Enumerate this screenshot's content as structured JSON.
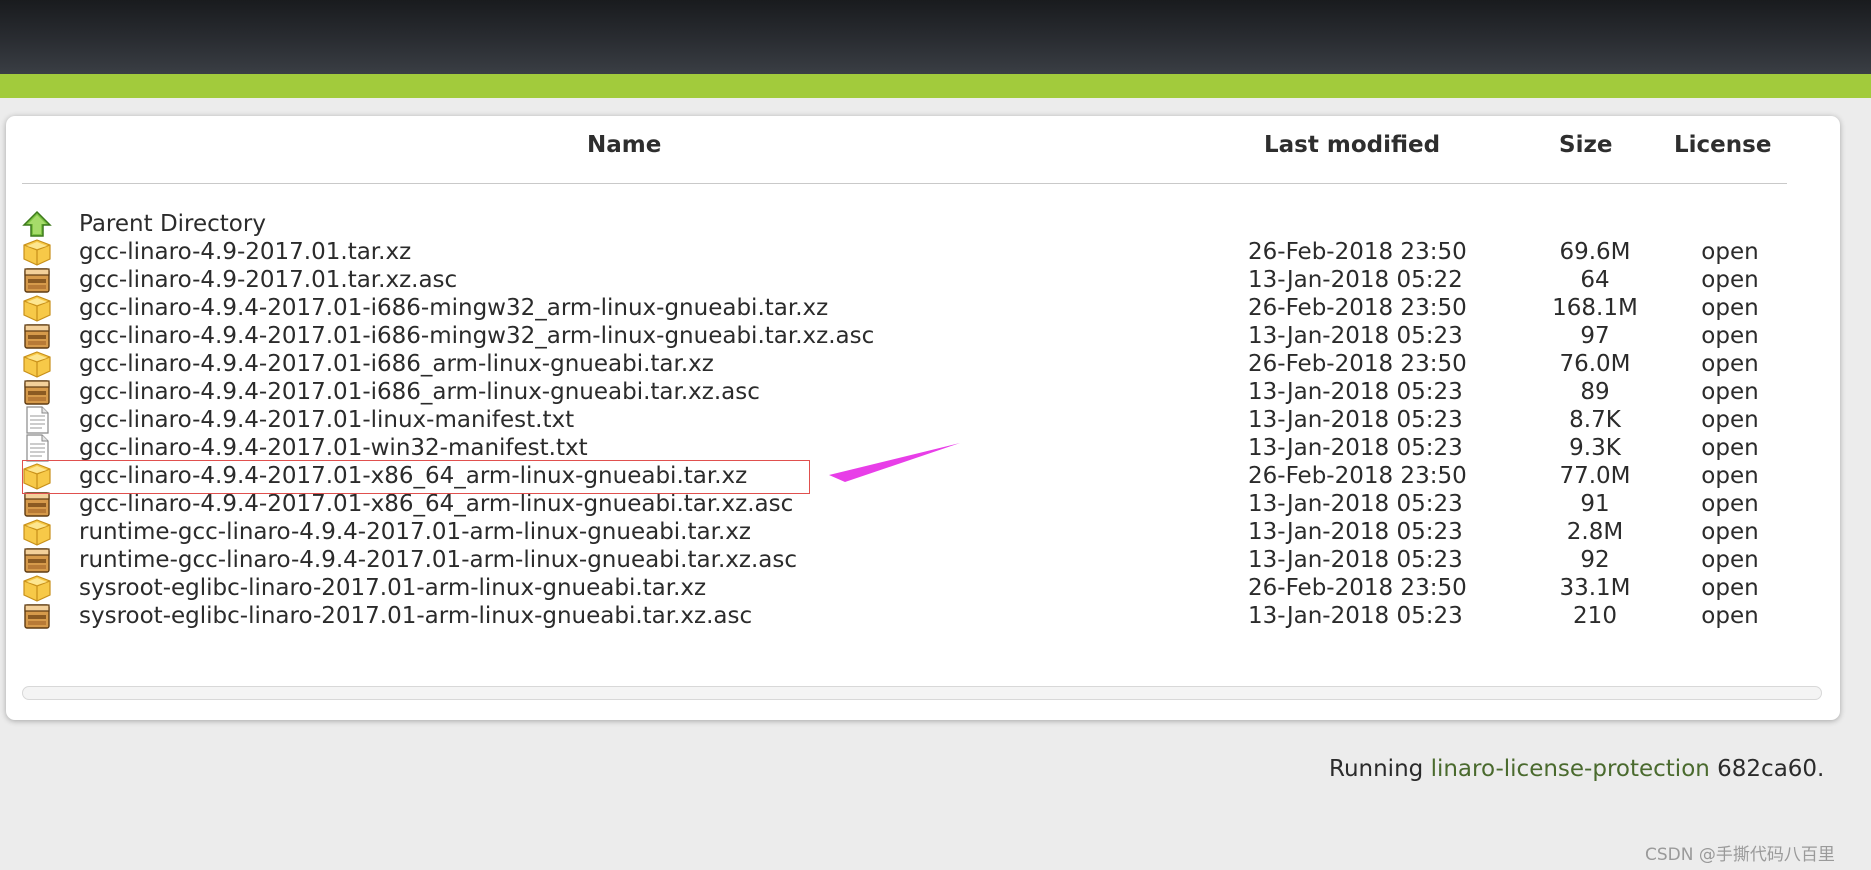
{
  "table": {
    "headers": {
      "name": "Name",
      "last_modified": "Last modified",
      "size": "Size",
      "license": "License"
    },
    "parent": {
      "label": "Parent Directory",
      "icon": "back-arrow-icon"
    },
    "rows": [
      {
        "name": "gcc-linaro-4.9-2017.01.tar.xz",
        "modified": "26-Feb-2018 23:50",
        "size": "69.6M",
        "license": "open",
        "icon": "archive-icon"
      },
      {
        "name": "gcc-linaro-4.9-2017.01.tar.xz.asc",
        "modified": "13-Jan-2018 05:22",
        "size": "64",
        "license": "open",
        "icon": "package-icon"
      },
      {
        "name": "gcc-linaro-4.9.4-2017.01-i686-mingw32_arm-linux-gnueabi.tar.xz",
        "modified": "26-Feb-2018 23:50",
        "size": "168.1M",
        "license": "open",
        "icon": "archive-icon"
      },
      {
        "name": "gcc-linaro-4.9.4-2017.01-i686-mingw32_arm-linux-gnueabi.tar.xz.asc",
        "modified": "13-Jan-2018 05:23",
        "size": "97",
        "license": "open",
        "icon": "package-icon"
      },
      {
        "name": "gcc-linaro-4.9.4-2017.01-i686_arm-linux-gnueabi.tar.xz",
        "modified": "26-Feb-2018 23:50",
        "size": "76.0M",
        "license": "open",
        "icon": "archive-icon"
      },
      {
        "name": "gcc-linaro-4.9.4-2017.01-i686_arm-linux-gnueabi.tar.xz.asc",
        "modified": "13-Jan-2018 05:23",
        "size": "89",
        "license": "open",
        "icon": "package-icon"
      },
      {
        "name": "gcc-linaro-4.9.4-2017.01-linux-manifest.txt",
        "modified": "13-Jan-2018 05:23",
        "size": "8.7K",
        "license": "open",
        "icon": "text-file-icon"
      },
      {
        "name": "gcc-linaro-4.9.4-2017.01-win32-manifest.txt",
        "modified": "13-Jan-2018 05:23",
        "size": "9.3K",
        "license": "open",
        "icon": "text-file-icon"
      },
      {
        "name": "gcc-linaro-4.9.4-2017.01-x86_64_arm-linux-gnueabi.tar.xz",
        "modified": "26-Feb-2018 23:50",
        "size": "77.0M",
        "license": "open",
        "icon": "archive-icon"
      },
      {
        "name": "gcc-linaro-4.9.4-2017.01-x86_64_arm-linux-gnueabi.tar.xz.asc",
        "modified": "13-Jan-2018 05:23",
        "size": "91",
        "license": "open",
        "icon": "package-icon"
      },
      {
        "name": "runtime-gcc-linaro-4.9.4-2017.01-arm-linux-gnueabi.tar.xz",
        "modified": "13-Jan-2018 05:23",
        "size": "2.8M",
        "license": "open",
        "icon": "archive-icon"
      },
      {
        "name": "runtime-gcc-linaro-4.9.4-2017.01-arm-linux-gnueabi.tar.xz.asc",
        "modified": "13-Jan-2018 05:23",
        "size": "92",
        "license": "open",
        "icon": "package-icon"
      },
      {
        "name": "sysroot-eglibc-linaro-2017.01-arm-linux-gnueabi.tar.xz",
        "modified": "26-Feb-2018 23:50",
        "size": "33.1M",
        "license": "open",
        "icon": "archive-icon"
      },
      {
        "name": "sysroot-eglibc-linaro-2017.01-arm-linux-gnueabi.tar.xz.asc",
        "modified": "13-Jan-2018 05:23",
        "size": "210",
        "license": "open",
        "icon": "package-icon"
      }
    ]
  },
  "footer": {
    "prefix": "Running ",
    "link": "linaro-license-protection",
    "suffix": " 682ca60."
  },
  "watermark": "CSDN @手撕代码八百里",
  "colors": {
    "accent_green": "#a2cb3c",
    "highlight_border": "#e0504e",
    "annotation_arrow": "#e83ee8"
  }
}
